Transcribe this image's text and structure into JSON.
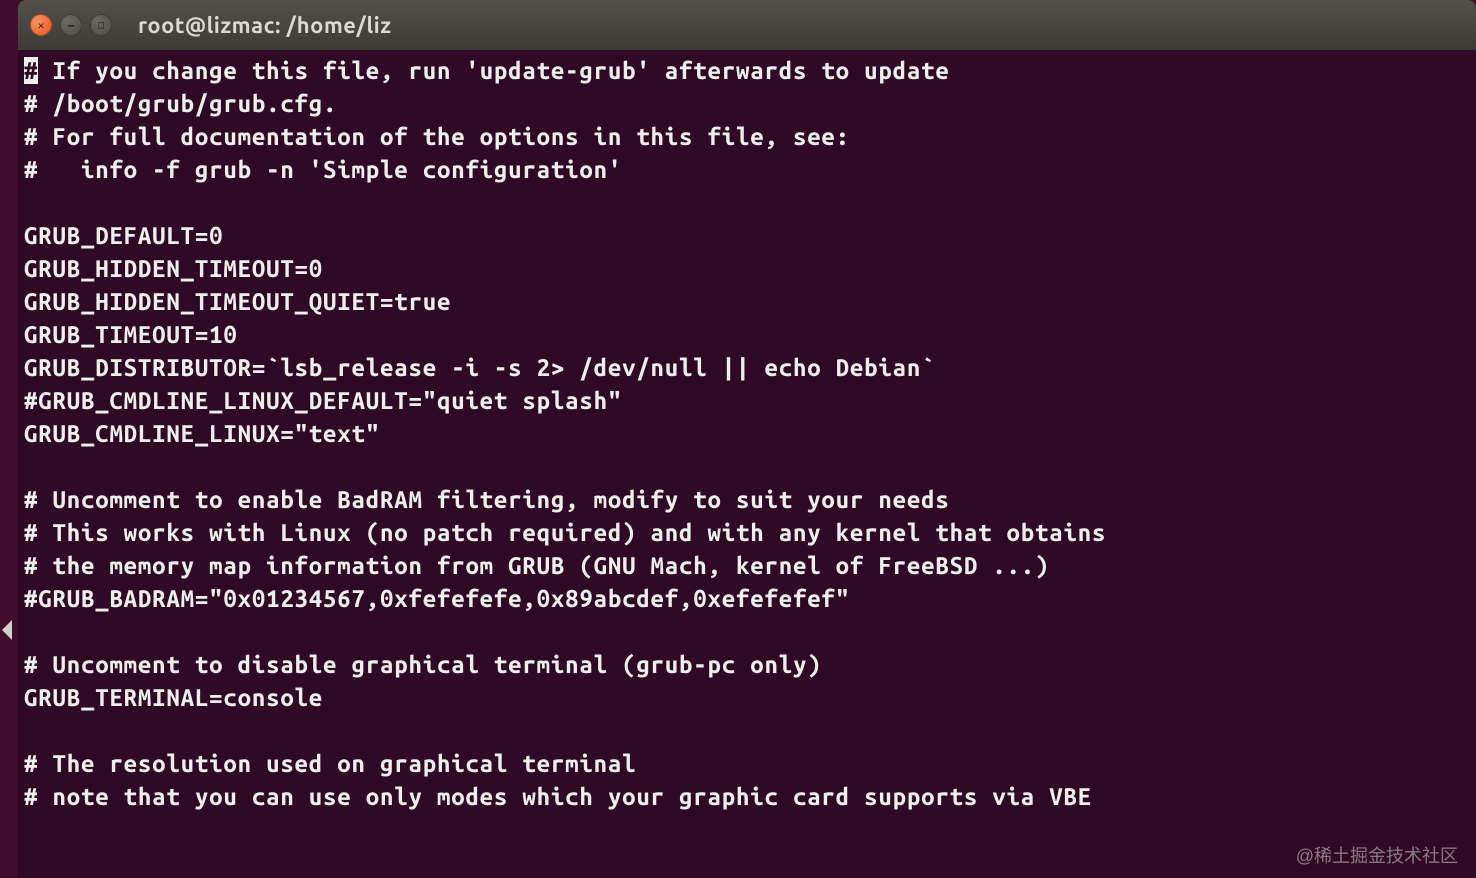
{
  "window": {
    "title": "root@lizmac: /home/liz"
  },
  "terminal": {
    "cursor_char": "#",
    "lines": [
      " If you change this file, run 'update-grub' afterwards to update",
      "# /boot/grub/grub.cfg.",
      "# For full documentation of the options in this file, see:",
      "#   info -f grub -n 'Simple configuration'",
      "",
      "GRUB_DEFAULT=0",
      "GRUB_HIDDEN_TIMEOUT=0",
      "GRUB_HIDDEN_TIMEOUT_QUIET=true",
      "GRUB_TIMEOUT=10",
      "GRUB_DISTRIBUTOR=`lsb_release -i -s 2> /dev/null || echo Debian`",
      "#GRUB_CMDLINE_LINUX_DEFAULT=\"quiet splash\"",
      "GRUB_CMDLINE_LINUX=\"text\"",
      "",
      "# Uncomment to enable BadRAM filtering, modify to suit your needs",
      "# This works with Linux (no patch required) and with any kernel that obtains",
      "# the memory map information from GRUB (GNU Mach, kernel of FreeBSD ...)",
      "#GRUB_BADRAM=\"0x01234567,0xfefefefe,0x89abcdef,0xefefefef\"",
      "",
      "# Uncomment to disable graphical terminal (grub-pc only)",
      "GRUB_TERMINAL=console",
      "",
      "# The resolution used on graphical terminal",
      "# note that you can use only modes which your graphic card supports via VBE"
    ]
  },
  "watermark": "@稀土掘金技术社区"
}
